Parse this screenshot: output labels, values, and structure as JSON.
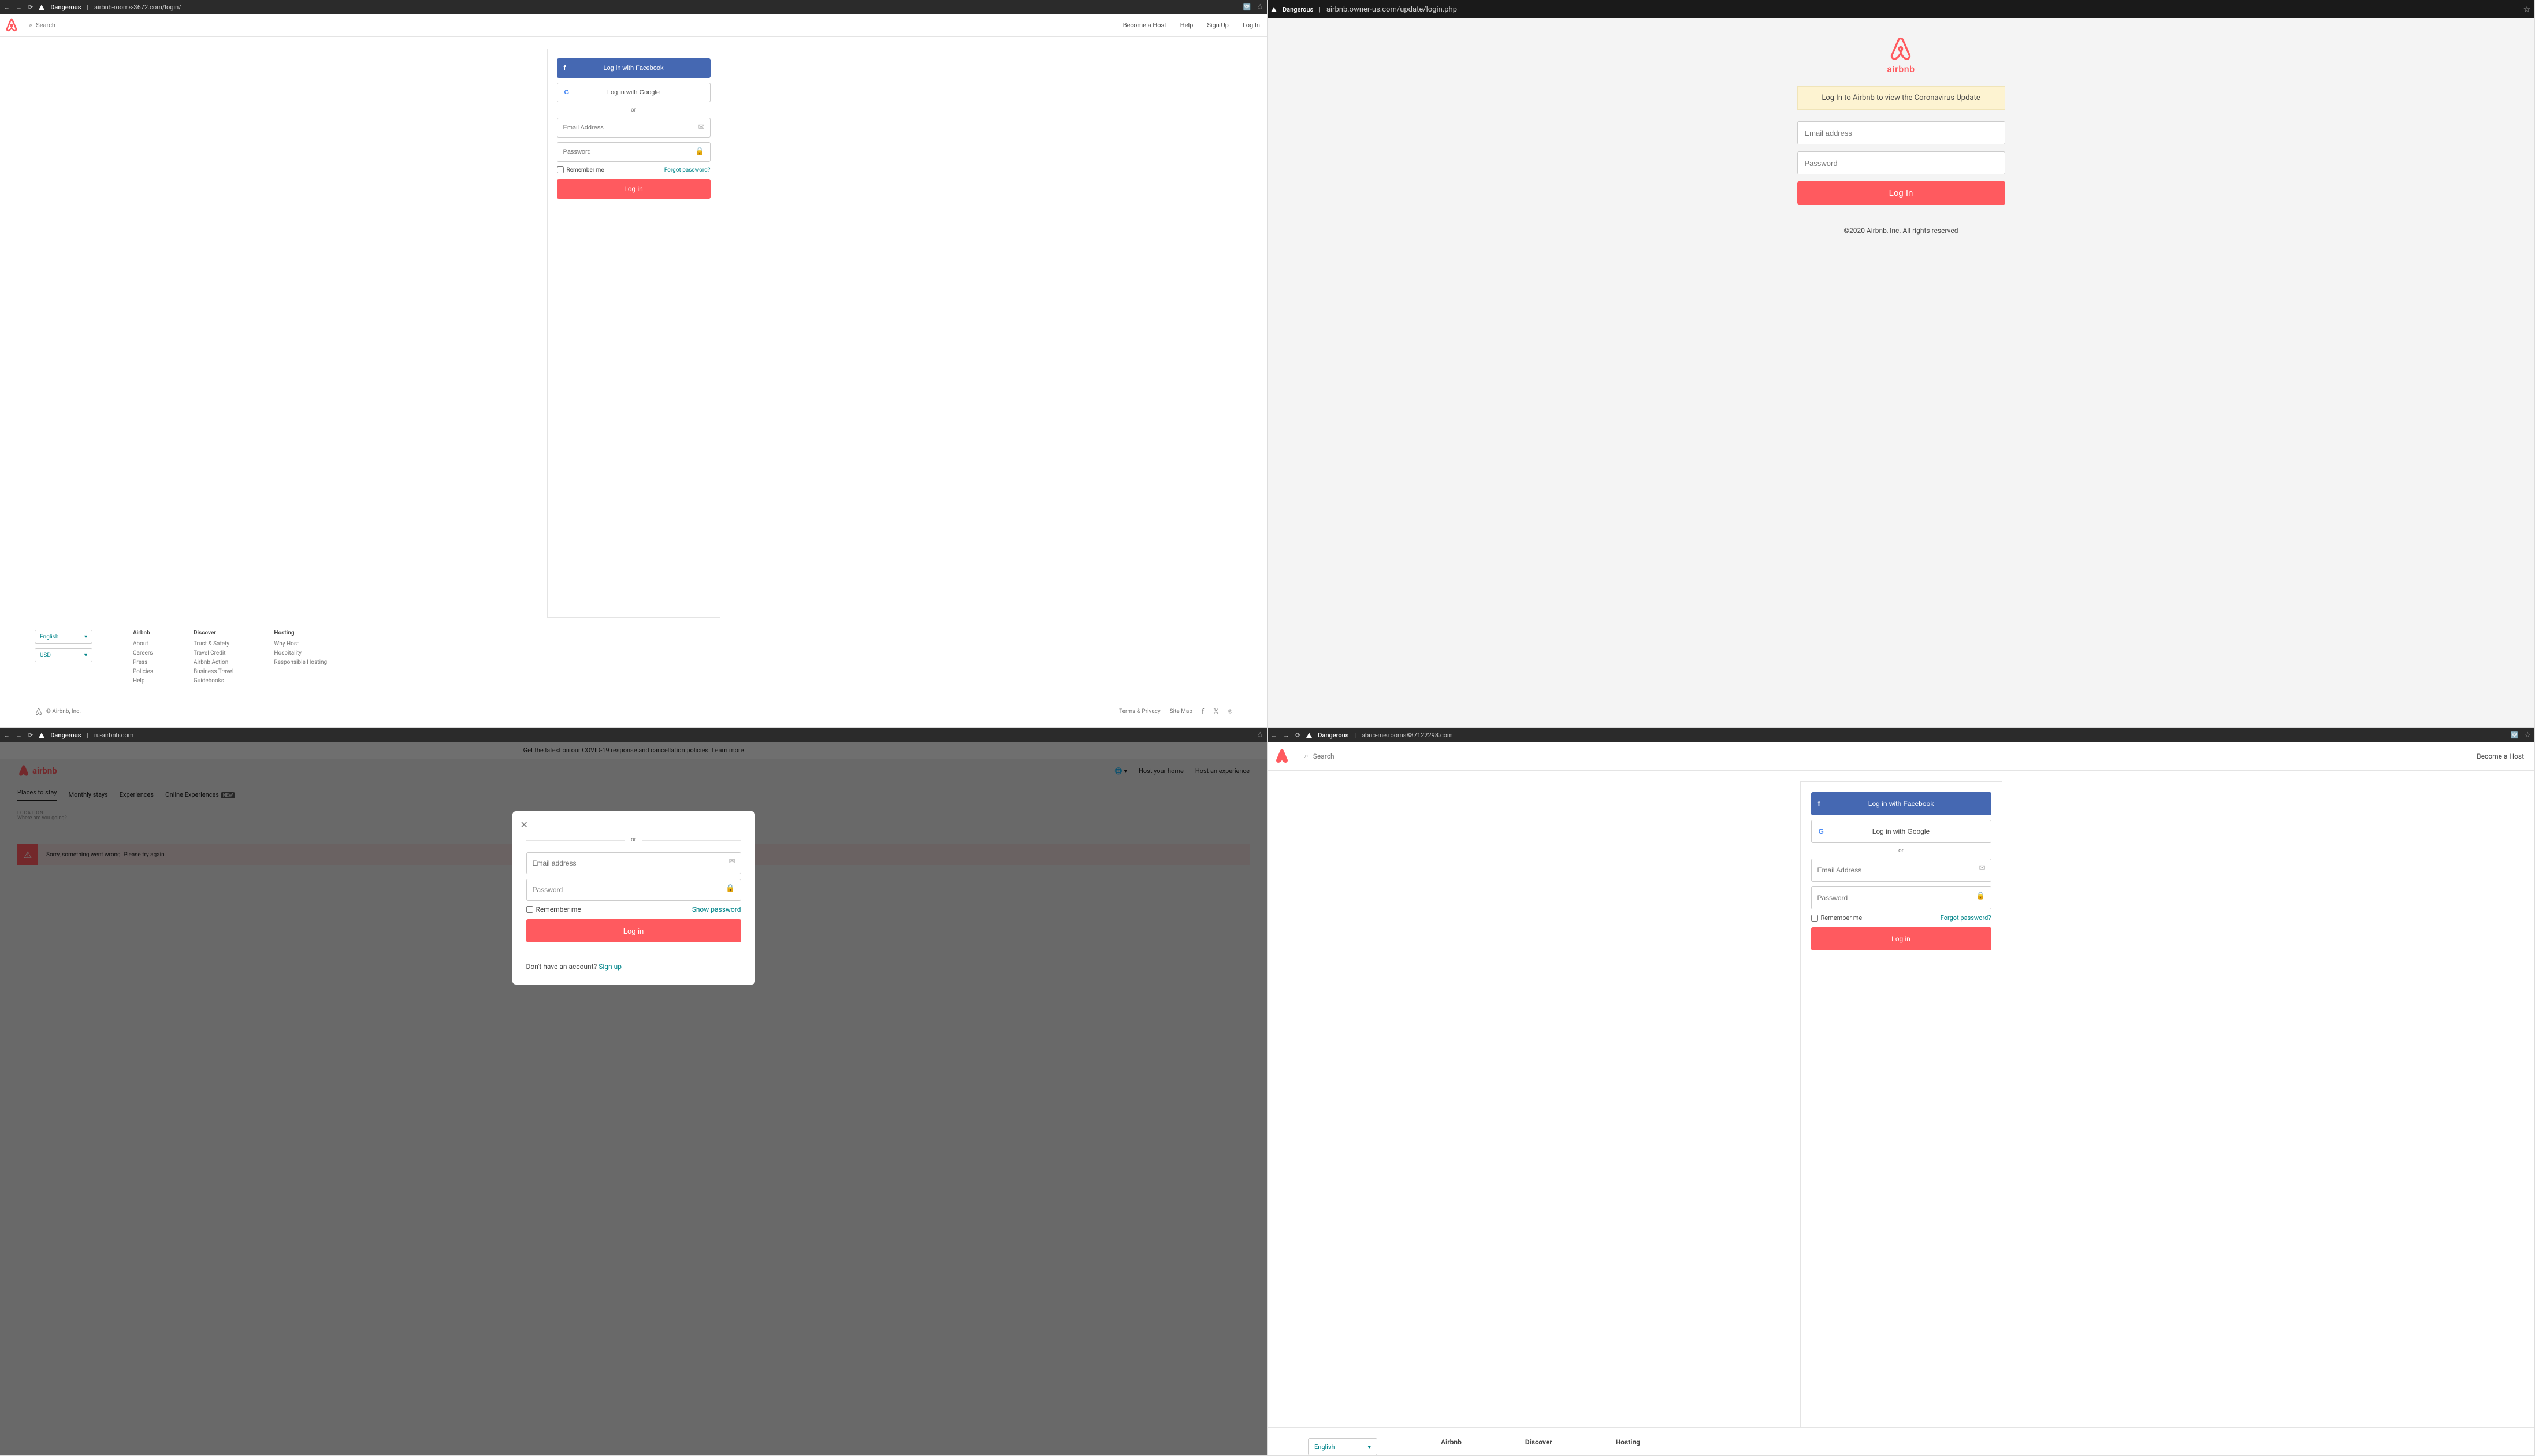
{
  "browser": {
    "danger_label": "Dangerous",
    "star": "☆",
    "translate_icon": "⟳"
  },
  "pane1": {
    "url": "airbnb-rooms-3672.com/login/",
    "search_placeholder": "Search",
    "nav": {
      "host": "Become a Host",
      "help": "Help",
      "signup": "Sign Up",
      "login": "Log In"
    },
    "login": {
      "fb": "Log in with Facebook",
      "google": "Log in with Google",
      "or": "or",
      "email_ph": "Email Address",
      "pass_ph": "Password",
      "remember": "Remember me",
      "forgot": "Forgot password?",
      "login_btn": "Log in"
    },
    "footer": {
      "lang": "English",
      "currency": "USD",
      "cols": [
        {
          "title": "Airbnb",
          "links": [
            "About",
            "Careers",
            "Press",
            "Policies",
            "Help"
          ]
        },
        {
          "title": "Discover",
          "links": [
            "Trust & Safety",
            "Travel Credit",
            "Airbnb Action",
            "Business Travel",
            "Guidebooks"
          ]
        },
        {
          "title": "Hosting",
          "links": [
            "Why Host",
            "Hospitality",
            "Responsible Hosting"
          ]
        }
      ],
      "copyright": "© Airbnb, Inc.",
      "terms": "Terms & Privacy",
      "sitemap": "Site Map"
    }
  },
  "pane2": {
    "url": "airbnb.owner-us.com/update/login.php",
    "brand": "airbnb",
    "banner": "Log In to Airbnb to view the Coronavirus Update",
    "email_ph": "Email address",
    "pass_ph": "Password",
    "login_btn": "Log In",
    "copyright": "©2020 Airbnb, Inc. All rights reserved"
  },
  "pane3": {
    "url": "ru-airbnb.com",
    "covid_text": "Get the latest on our COVID-19 response and cancellation policies. ",
    "covid_link": "Learn more",
    "brand": "airbnb",
    "nav": {
      "host_home": "Host your home",
      "host_exp": "Host an experience"
    },
    "tabs": {
      "places": "Places to stay",
      "monthly": "Monthly stays",
      "exp": "Experiences",
      "online": "Online Experiences",
      "new": "NEW"
    },
    "loc_label": "LOCATION",
    "loc_ph": "Where are you going?",
    "error": "Sorry, something went wrong. Please try again.",
    "modal": {
      "or": "or",
      "email_ph": "Email address",
      "pass_ph": "Password",
      "remember": "Remember me",
      "show_pw": "Show password",
      "login_btn": "Log in",
      "no_account": "Don't have an account?  ",
      "signup": "Sign up"
    }
  },
  "pane4": {
    "url": "abnb-me.rooms887122298.com",
    "search_placeholder": "Search",
    "nav_host": "Become a Host",
    "login": {
      "fb": "Log in with Facebook",
      "google": "Log in with Google",
      "or": "or",
      "email_ph": "Email Address",
      "pass_ph": "Password",
      "remember": "Remember me",
      "forgot": "Forgot password?",
      "login_btn": "Log in"
    },
    "footer": {
      "lang": "English",
      "cols": [
        "Airbnb",
        "Discover",
        "Hosting"
      ]
    }
  }
}
